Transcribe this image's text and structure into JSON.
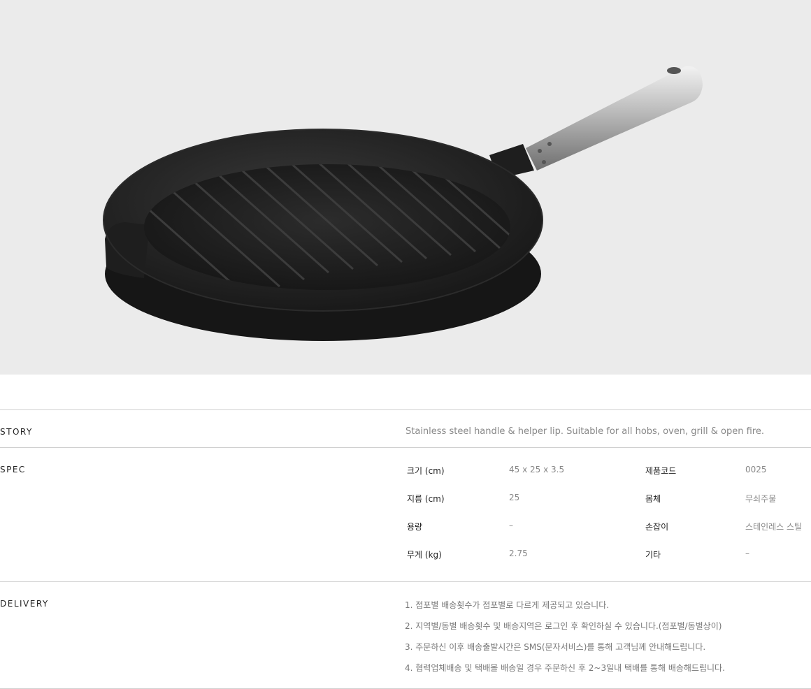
{
  "product_image": {
    "subject": "cast-iron-grill-pan",
    "colors": {
      "background": "#ebebeb",
      "pan": "#1b1b1b",
      "handle": "#c8c8c8"
    }
  },
  "story": {
    "label": "STORY",
    "text": "Stainless steel handle & helper lip. Suitable for all hobs, oven, grill & open fire."
  },
  "spec": {
    "label": "SPEC",
    "left": [
      {
        "key": "크기 (cm)",
        "value": "45 x 25 x 3.5"
      },
      {
        "key": "지름 (cm)",
        "value": "25"
      },
      {
        "key": "용량",
        "value": "–"
      },
      {
        "key": "무게 (kg)",
        "value": "2.75"
      }
    ],
    "right": [
      {
        "key": "제품코드",
        "value": "0025"
      },
      {
        "key": "몸체",
        "value": "무쇠주물"
      },
      {
        "key": "손잡이",
        "value": "스테인레스 스틸"
      },
      {
        "key": "기타",
        "value": "–"
      }
    ]
  },
  "delivery": {
    "label": "DELIVERY",
    "items": [
      "1. 점포별 배송횟수가 점포별로 다르게 제공되고 있습니다.",
      "2. 지역별/동별 배송횟수 및 배송지역은 로그인 후 확인하실 수 있습니다.(점포별/동별상이)",
      "3. 주문하신 이후 배송출발시간은 SMS(문자서비스)를 통해 고객님께 안내해드립니다.",
      "4. 협력업체배송 및 택배몰 배송일 경우 주문하신 후 2~3일내 택배를 통해 배송해드립니다."
    ]
  }
}
